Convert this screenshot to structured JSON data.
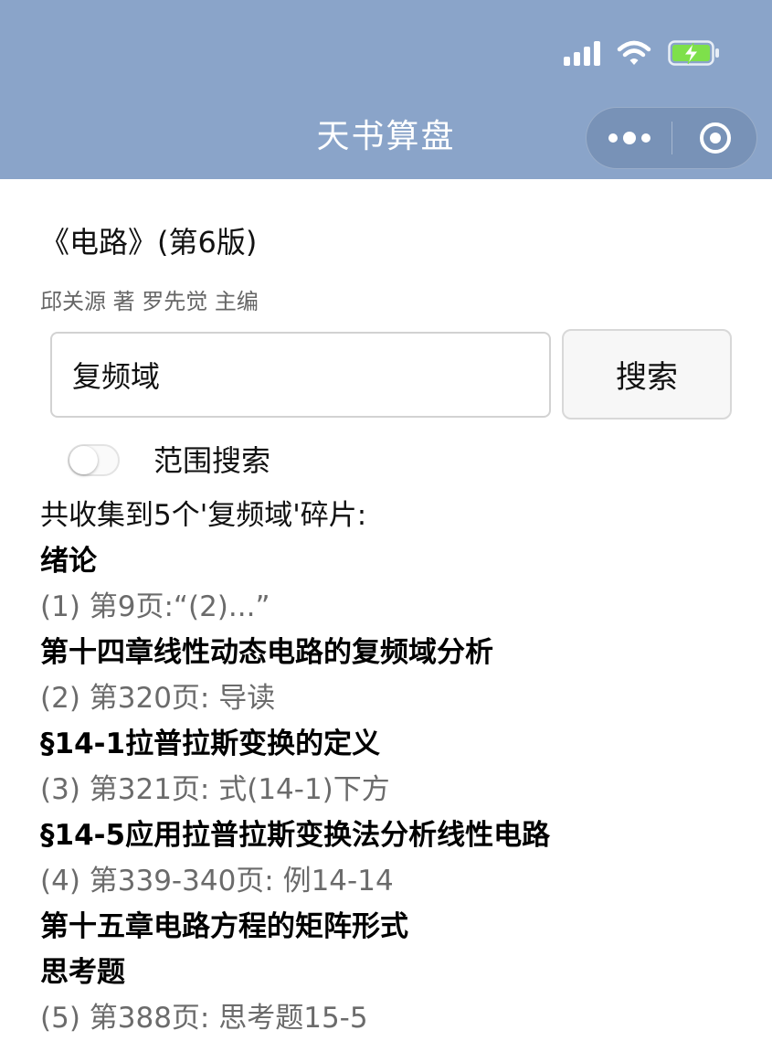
{
  "status_bar": {
    "icons": [
      "signal-icon",
      "wifi-icon",
      "battery-charging-icon"
    ],
    "battery_color": "#7ee04b"
  },
  "nav": {
    "title": "天书算盘",
    "more_icon": "more-dots-icon",
    "close_icon": "target-close-icon",
    "bar_color": "#8aa4c9"
  },
  "book": {
    "title": "《电路》(第6版)",
    "authors": "邱关源 著 罗先觉 主编"
  },
  "search": {
    "value": "复频域",
    "placeholder": "",
    "button_label": "搜索"
  },
  "range_search": {
    "label": "范围搜索",
    "enabled": false
  },
  "results": {
    "summary": "共收集到5个'复频域'碎片:",
    "lines": [
      {
        "type": "heading",
        "text": "绪论"
      },
      {
        "type": "entry",
        "text": "(1) 第9页:“(2)...”"
      },
      {
        "type": "heading",
        "text": "第十四章线性动态电路的复频域分析"
      },
      {
        "type": "entry",
        "text": "(2) 第320页: 导读"
      },
      {
        "type": "heading",
        "text": "§14-1拉普拉斯变换的定义"
      },
      {
        "type": "entry",
        "text": "(3) 第321页: 式(14-1)下方"
      },
      {
        "type": "heading",
        "text": "§14-5应用拉普拉斯变换法分析线性电路"
      },
      {
        "type": "entry",
        "text": "(4) 第339-340页: 例14-14"
      },
      {
        "type": "heading",
        "text": "第十五章电路方程的矩阵形式"
      },
      {
        "type": "heading",
        "text": "思考题"
      },
      {
        "type": "entry",
        "text": "(5) 第388页: 思考题15-5"
      }
    ]
  }
}
